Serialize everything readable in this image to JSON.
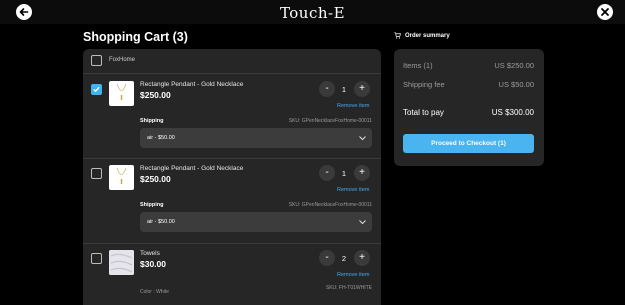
{
  "header": {
    "logo_text": "Touch-E",
    "logo_icon": "touch-e-logo",
    "back_icon": "arrow-left-icon",
    "close_icon": "close-icon"
  },
  "cart": {
    "title": "Shopping Cart (3)",
    "store_name": "FoxHome",
    "items": [
      {
        "name": "Rectangle Pendant - Gold Necklace",
        "price": "$250.00",
        "quantity": "1",
        "checked": true,
        "minus_label": "-",
        "plus_label": "+",
        "remove_label": "Remove item",
        "shipping_label": "Shipping",
        "sku": "SKU: GPenNecklaceFoxHome-00011",
        "shipping_option": "air - $50.00"
      },
      {
        "name": "Rectangle Pendant - Gold Necklace",
        "price": "$250.00",
        "quantity": "1",
        "checked": false,
        "minus_label": "-",
        "plus_label": "+",
        "remove_label": "Remove item",
        "shipping_label": "Shipping",
        "sku": "SKU: GPenNecklaceFoxHome-00011",
        "shipping_option": "air - $50.00"
      },
      {
        "name": "Towels",
        "price": "$30.00",
        "quantity": "2",
        "checked": false,
        "minus_label": "-",
        "plus_label": "+",
        "remove_label": "Remove item",
        "color_label": "Color : White",
        "sku": "SKU: FH-T01WHITE"
      }
    ]
  },
  "summary": {
    "title": "Order summary",
    "items_label": "Items (1)",
    "items_value": "US $250.00",
    "shipping_label": "Shipping fee",
    "shipping_value": "US $50.00",
    "total_label": "Total to pay",
    "total_value": "US $300.00",
    "checkout_label": "Proceed to Checkout (1)"
  },
  "colors": {
    "accent": "#49b4f0",
    "panel": "#262626",
    "background": "#000000"
  }
}
